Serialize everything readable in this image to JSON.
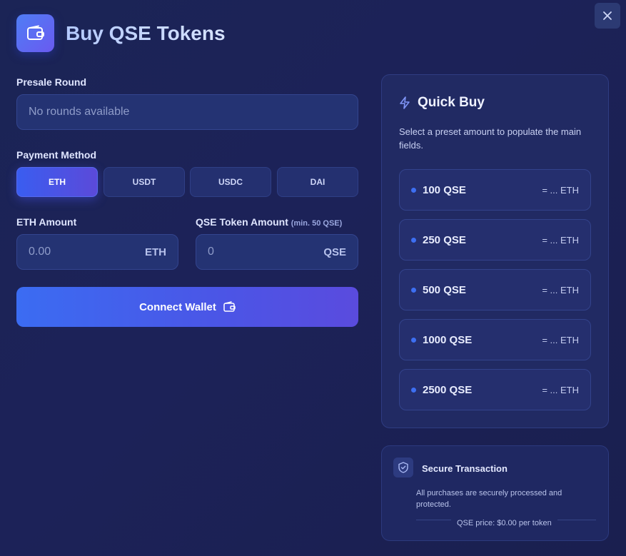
{
  "header": {
    "title": "Buy QSE Tokens",
    "icon": "wallet-icon"
  },
  "presale": {
    "label": "Presale Round",
    "value": "No rounds available"
  },
  "payment": {
    "label": "Payment Method",
    "methods": [
      "ETH",
      "USDT",
      "USDC",
      "DAI"
    ],
    "selected": "ETH"
  },
  "eth_amount": {
    "label": "ETH Amount",
    "placeholder": "0.00",
    "suffix": "ETH"
  },
  "qse_amount": {
    "label": "QSE Token Amount",
    "hint": "(min. 50 QSE)",
    "placeholder": "0",
    "suffix": "QSE"
  },
  "connect": {
    "label": "Connect Wallet"
  },
  "quick_buy": {
    "title": "Quick Buy",
    "description": "Select a preset amount to populate the main fields.",
    "presets": [
      {
        "amount": "100 QSE",
        "equiv": "= ... ETH"
      },
      {
        "amount": "250 QSE",
        "equiv": "= ... ETH"
      },
      {
        "amount": "500 QSE",
        "equiv": "= ... ETH"
      },
      {
        "amount": "1000 QSE",
        "equiv": "= ... ETH"
      },
      {
        "amount": "2500 QSE",
        "equiv": "= ... ETH"
      }
    ]
  },
  "secure": {
    "title": "Secure Transaction",
    "description": "All purchases are securely processed and protected.",
    "price": "QSE price: $0.00 per token"
  },
  "colors": {
    "accent": "#3b6cf2",
    "accent2": "#5a4bde",
    "background": "#1b2456"
  }
}
